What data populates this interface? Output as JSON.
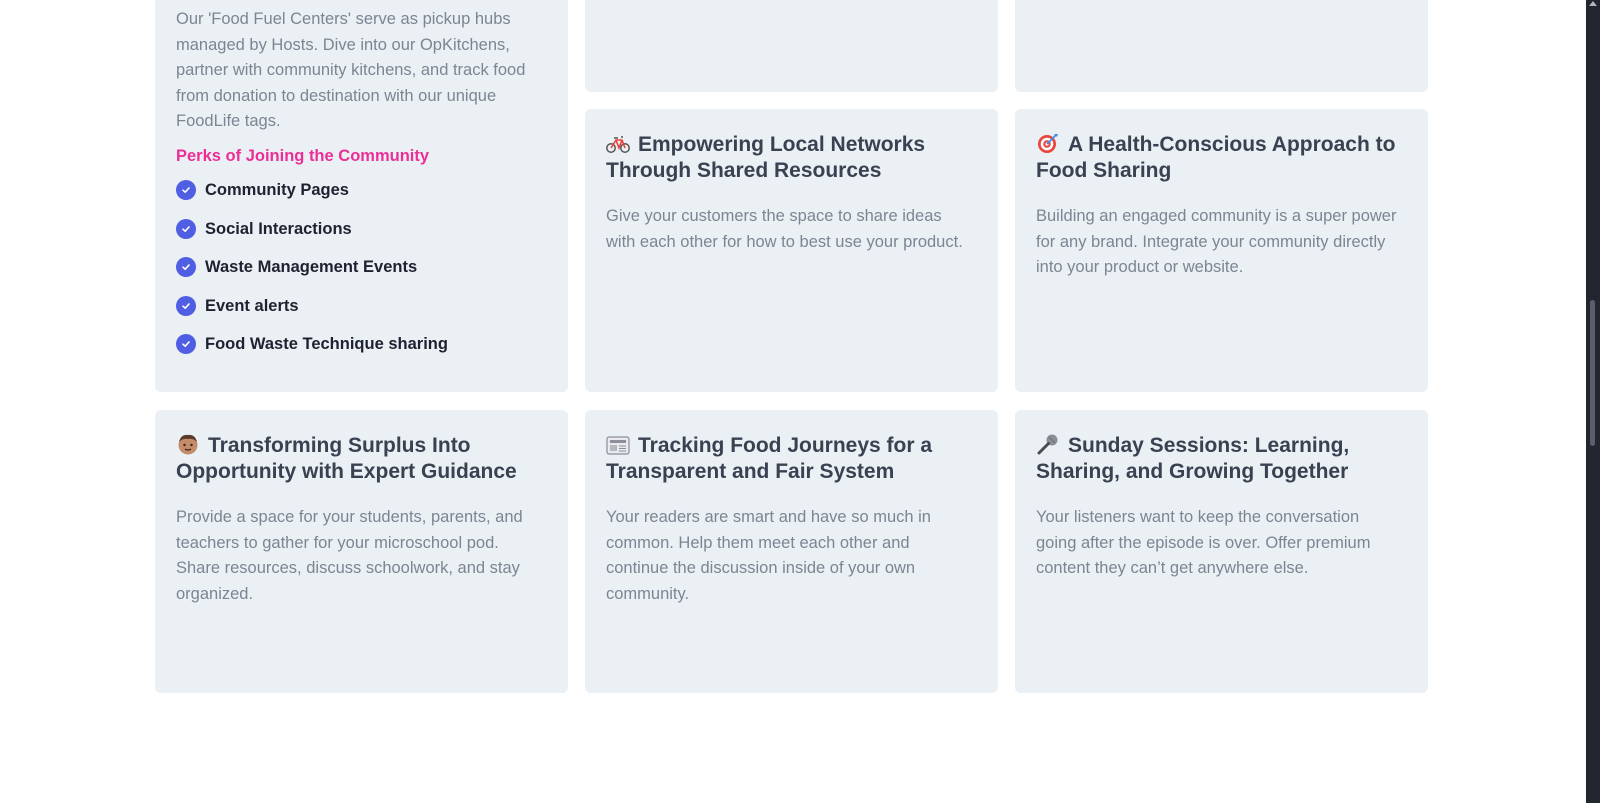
{
  "card_intro": {
    "desc": "Our 'Food Fuel Centers' serve as pickup hubs managed by Hosts. Dive into our OpKitchens, partner with community kitchens, and track food from donation to destination with our unique FoodLife tags.",
    "perks_heading": "Perks of Joining the Community",
    "perks": [
      {
        "label": "Community Pages"
      },
      {
        "label": "Social Interactions"
      },
      {
        "label": "Waste Management Events"
      },
      {
        "label": "Event alerts"
      },
      {
        "label": "Food Waste Technique sharing"
      }
    ]
  },
  "cards": [
    {
      "icon": "bicycle-icon",
      "title": "Empowering Local Networks Through Shared Resources",
      "desc": "Give your customers the space to share ideas with each other for how to best use your product."
    },
    {
      "icon": "target-icon",
      "title": "A Health-Conscious Approach to Food Sharing",
      "desc": "Building an engaged community is a super power for any brand. Integrate your community directly into your product or website."
    },
    {
      "icon": "person-icon",
      "title": "Transforming Surplus Into Opportunity with Expert Guidance",
      "desc": "Provide a space for your students, parents, and teachers to gather for your microschool pod. Share resources, discuss schoolwork, and stay organized."
    },
    {
      "icon": "newspaper-icon",
      "title": "Tracking Food Journeys for a Transparent and Fair System",
      "desc": "Your readers are smart and have so much in common. Help them meet each other and continue the discussion inside of your own community."
    },
    {
      "icon": "microphone-icon",
      "title": "Sunday Sessions: Learning, Sharing, and Growing Together",
      "desc": "Your listeners want to keep the conversation going after the episode is over. Offer premium content they can’t get anywhere else."
    }
  ],
  "colors": {
    "card_bg": "#ebf0f5",
    "accent_pink": "#ec2f97",
    "check_blue": "#4f5ee3"
  }
}
